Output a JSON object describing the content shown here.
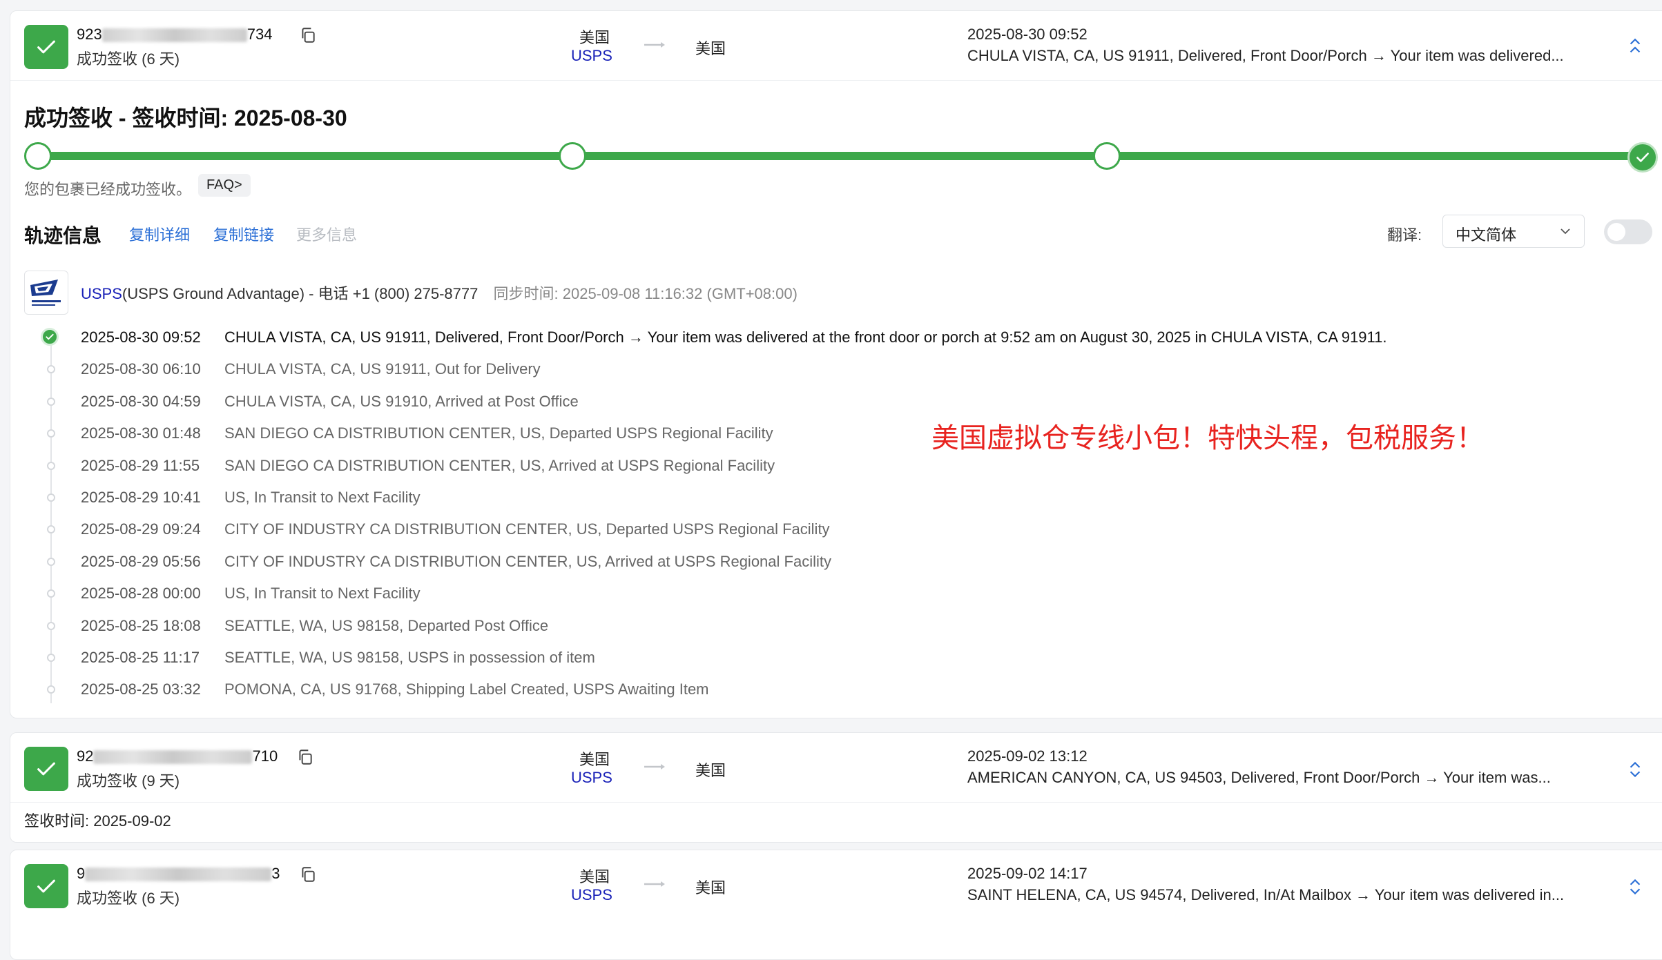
{
  "shipment1": {
    "tracking_prefix": "923",
    "tracking_suffix": "734",
    "status": "成功签收 (6 天)",
    "origin_country": "美国",
    "carrier": "USPS",
    "dest_country": "美国",
    "latest_time": "2025-08-30 09:52",
    "latest_desc": "CHULA VISTA, CA, US 91911, Delivered, Front Door/Porch → Your item was delivered...",
    "heading": "成功签收 - 签收时间: 2025-08-30",
    "note": "您的包裹已经成功签收。",
    "faq_label": "FAQ>",
    "progress_steps": 4,
    "progress_completed": 4
  },
  "track_info": {
    "title": "轨迹信息",
    "copy_detail": "复制详细",
    "copy_link": "复制链接",
    "more_info": "更多信息",
    "translate_label": "翻译:",
    "language": "中文简体",
    "translate_on": false
  },
  "carrier_info": {
    "name": "USPS",
    "service": "(USPS Ground Advantage) - 电话 +1 (800) 275-8777",
    "sync": "同步时间: 2025-09-08 11:16:32 (GMT+08:00)",
    "logo_text": "UNITED STATES POSTAL SERVICE"
  },
  "events": [
    {
      "time": "2025-08-30 09:52",
      "desc": "CHULA VISTA, CA, US 91911, Delivered, Front Door/Porch → Your item was delivered at the front door or porch at 9:52 am on August 30, 2025 in CHULA VISTA, CA 91911."
    },
    {
      "time": "2025-08-30 06:10",
      "desc": "CHULA VISTA, CA, US 91911, Out for Delivery"
    },
    {
      "time": "2025-08-30 04:59",
      "desc": "CHULA VISTA, CA, US 91910, Arrived at Post Office"
    },
    {
      "time": "2025-08-30 01:48",
      "desc": "SAN DIEGO CA DISTRIBUTION CENTER, US, Departed USPS Regional Facility"
    },
    {
      "time": "2025-08-29 11:55",
      "desc": "SAN DIEGO CA DISTRIBUTION CENTER, US, Arrived at USPS Regional Facility"
    },
    {
      "time": "2025-08-29 10:41",
      "desc": "US, In Transit to Next Facility"
    },
    {
      "time": "2025-08-29 09:24",
      "desc": "CITY OF INDUSTRY CA DISTRIBUTION CENTER, US, Departed USPS Regional Facility"
    },
    {
      "time": "2025-08-29 05:56",
      "desc": "CITY OF INDUSTRY CA DISTRIBUTION CENTER, US, Arrived at USPS Regional Facility"
    },
    {
      "time": "2025-08-28 00:00",
      "desc": "US, In Transit to Next Facility"
    },
    {
      "time": "2025-08-25 18:08",
      "desc": "SEATTLE, WA, US 98158, Departed Post Office"
    },
    {
      "time": "2025-08-25 11:17",
      "desc": "SEATTLE, WA, US 98158, USPS in possession of item"
    },
    {
      "time": "2025-08-25 03:32",
      "desc": "POMONA, CA, US 91768, Shipping Label Created, USPS Awaiting Item"
    }
  ],
  "promo": "美国虚拟仓专线小包！特快头程，包税服务！",
  "promo_color": "#e8231f",
  "shipment2": {
    "tracking_prefix": "92",
    "tracking_suffix": "710",
    "status": "成功签收 (9 天)",
    "origin_country": "美国",
    "carrier": "USPS",
    "dest_country": "美国",
    "latest_time": "2025-09-02 13:12",
    "latest_desc": "AMERICAN CANYON, CA, US 94503, Delivered, Front Door/Porch → Your item was...",
    "delivered": "签收时间: 2025-09-02"
  },
  "shipment3": {
    "tracking_prefix": "9",
    "tracking_suffix": "3",
    "status": "成功签收 (6 天)",
    "origin_country": "美国",
    "carrier": "USPS",
    "dest_country": "美国",
    "latest_time": "2025-09-02 14:17",
    "latest_desc": "SAINT HELENA, CA, US 94574, Delivered, In/At Mailbox → Your item was delivered in..."
  },
  "colors": {
    "success": "#3da84a",
    "link": "#2b6fd6",
    "carrier": "#1a22b8"
  }
}
